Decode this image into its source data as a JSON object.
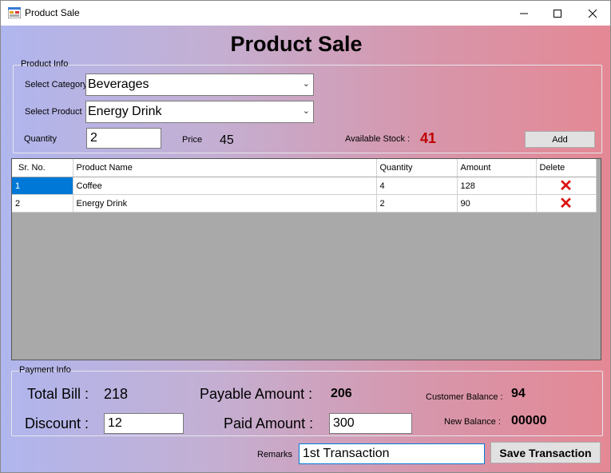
{
  "window": {
    "title": "Product Sale"
  },
  "heading": "Product Sale",
  "product_info": {
    "title": "Product Info",
    "category_label": "Select Category",
    "category_value": "Beverages",
    "product_label": "Select Product",
    "product_value": "Energy Drink",
    "quantity_label": "Quantity",
    "quantity_value": "2",
    "price_label": "Price",
    "price_value": "45",
    "stock_label": "Available Stock :",
    "stock_value": "41",
    "add_label": "Add"
  },
  "grid": {
    "columns": [
      "Sr. No.",
      "Product Name",
      "Quantity",
      "Amount",
      "Delete"
    ],
    "rows": [
      {
        "sr": "1",
        "name": "Coffee",
        "qty": "4",
        "amount": "128",
        "delete": "✕"
      },
      {
        "sr": "2",
        "name": "Energy Drink",
        "qty": "2",
        "amount": "90",
        "delete": "✕"
      }
    ]
  },
  "payment_info": {
    "title": "Payment Info",
    "total_bill_label": "Total Bill :",
    "total_bill_value": "218",
    "payable_label": "Payable Amount :",
    "payable_value": "206",
    "customer_balance_label": "Customer Balance :",
    "customer_balance_value": "94",
    "discount_label": "Discount :",
    "discount_value": "12",
    "paid_label": "Paid Amount :",
    "paid_value": "300",
    "new_balance_label": "New Balance :",
    "new_balance_value": "00000"
  },
  "remarks": {
    "label": "Remarks",
    "value": "1st Transaction"
  },
  "save_label": "Save Transaction",
  "colors": {
    "stock": "#c00000",
    "delete": "#dd1111",
    "selection": "#0078d7"
  }
}
